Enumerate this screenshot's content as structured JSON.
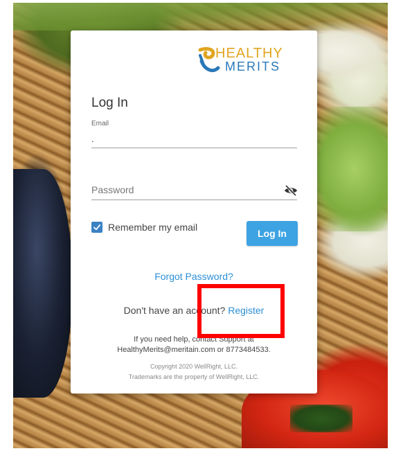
{
  "brand": {
    "name_top": "HEALTHY",
    "name_bottom": "MERITS",
    "color_gold": "#e0a520",
    "color_blue": "#2a78b8"
  },
  "login": {
    "heading": "Log In",
    "email_label": "Email",
    "email_value": ".",
    "password_placeholder": "Password",
    "password_toggle_icon": "eye-slash-icon",
    "remember_label": "Remember my email",
    "remember_checked": true,
    "submit_label": "Log In",
    "forgot_label": "Forgot Password?",
    "register_prompt": "Don't have an account? ",
    "register_label": "Register",
    "help_line1": "If you need help, contact Support at",
    "help_line2": "HealthyMerits@meritain.com or 8773484533.",
    "copyright": "Copyright 2020 WellRight, LLC.",
    "trademark": "Trademarks are the property of WellRight, LLC."
  },
  "colors": {
    "primary_button": "#3da3e3",
    "link": "#2b8fd6",
    "highlight": "#ff0000"
  }
}
